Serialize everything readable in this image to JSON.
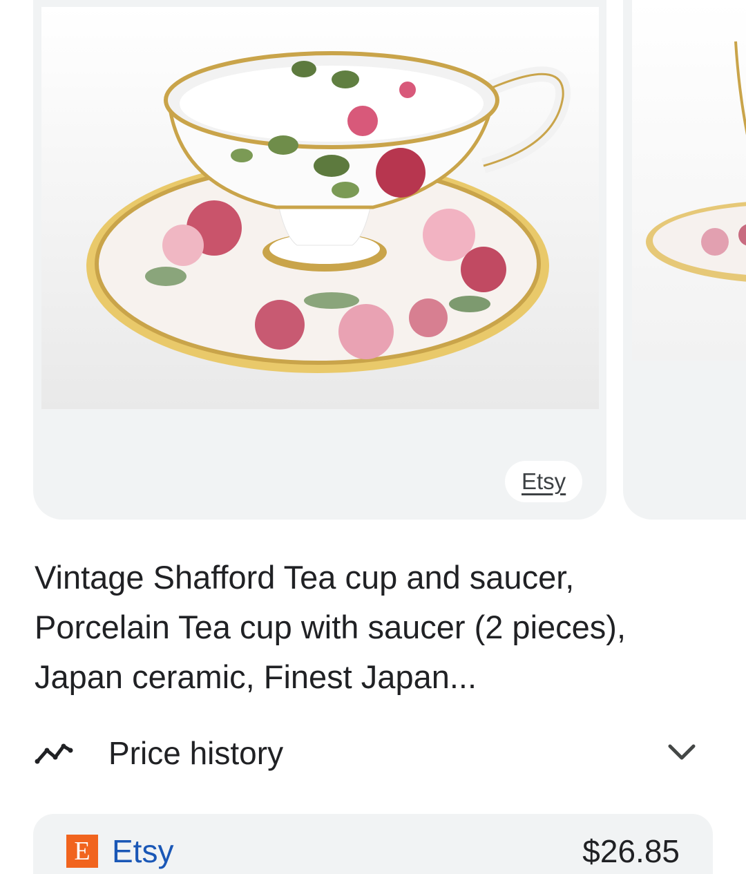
{
  "carousel": {
    "source_chip": "Etsy"
  },
  "product": {
    "title": "Vintage Shafford Tea cup and saucer, Porcelain Tea cup with saucer (2 pieces), Japan ceramic, Finest Japan..."
  },
  "price_history": {
    "label": "Price history",
    "icon": "trending-line-icon",
    "expand_icon": "chevron-down-icon"
  },
  "offers": [
    {
      "seller": "Etsy",
      "seller_logo_letter": "E",
      "price": "$26.85"
    }
  ],
  "colors": {
    "card_background": "#f1f3f4",
    "seller_link": "#1a57b6",
    "etsy_brand": "#f1641e"
  }
}
